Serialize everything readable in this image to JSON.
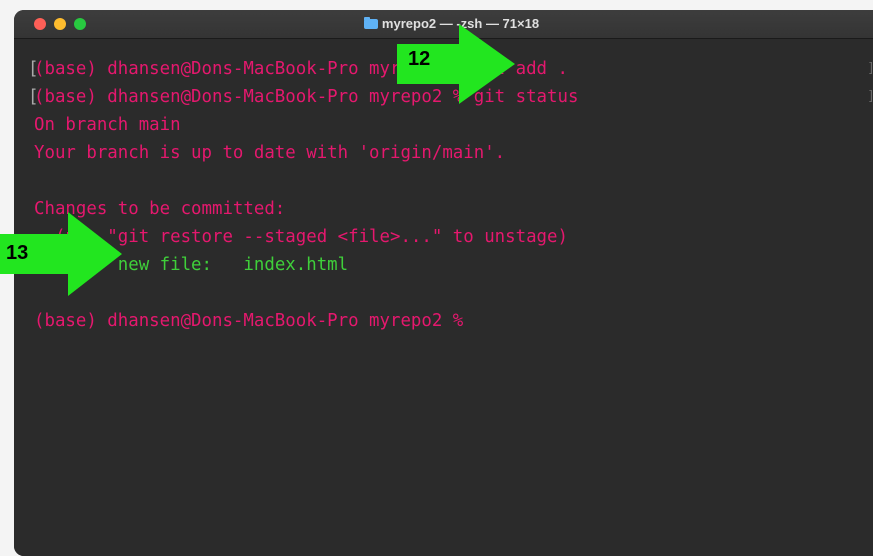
{
  "window": {
    "title": "myrepo2 — -zsh — 71×18"
  },
  "terminal": {
    "lines": [
      {
        "text": "(base) dhansen@Dons-MacBook-Pro myrepo2 % git add ."
      },
      {
        "text": "(base) dhansen@Dons-MacBook-Pro myrepo2 % git status"
      },
      {
        "text": "On branch main"
      },
      {
        "text": "Your branch is up to date with 'origin/main'."
      },
      {
        "text": ""
      },
      {
        "text": "Changes to be committed:"
      },
      {
        "text": "  (use \"git restore --staged <file>...\" to unstage)"
      },
      {
        "text": "\tnew file:   index.html"
      },
      {
        "text": ""
      },
      {
        "text": "(base) dhansen@Dons-MacBook-Pro myrepo2 %"
      }
    ]
  },
  "annotations": {
    "arrow_12": "12",
    "arrow_13": "13"
  },
  "colors": {
    "prompt_text": "#e5186e",
    "staged_file": "#3fcf3a",
    "arrow": "#22e61f"
  },
  "icons": {
    "title_folder": "folder-icon"
  }
}
